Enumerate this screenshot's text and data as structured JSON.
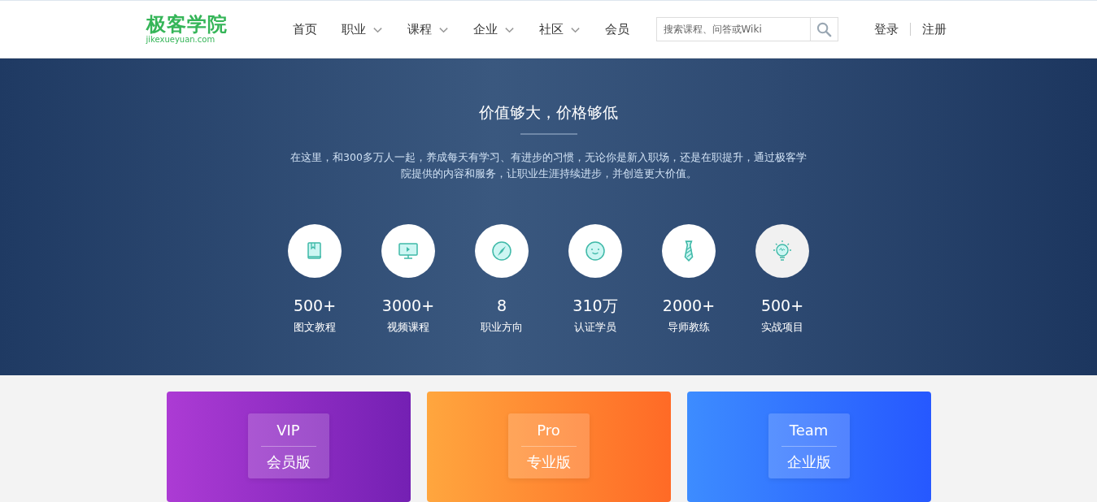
{
  "logo": {
    "name": "极客学院",
    "domain": "jikexueyuan.com"
  },
  "nav": [
    {
      "label": "首页",
      "has_menu": false
    },
    {
      "label": "职业",
      "has_menu": true
    },
    {
      "label": "课程",
      "has_menu": true
    },
    {
      "label": "企业",
      "has_menu": true
    },
    {
      "label": "社区",
      "has_menu": true
    },
    {
      "label": "会员",
      "has_menu": false
    }
  ],
  "search": {
    "placeholder": "搜索课程、问答或Wiki"
  },
  "auth": [
    "登录",
    "注册"
  ],
  "hero": {
    "title": "价值够大，价格够低",
    "text": "在这里，和300多万人一起，养成每天有学习、有进步的习惯，无论你是新入职场，还是在职提升，通过极客学院提供的内容和服务，让职业生涯持续进步，并创造更大价值。"
  },
  "stats": [
    {
      "kind": "book",
      "value": "500+",
      "label": "图文教程",
      "highlighted": false
    },
    {
      "kind": "monitor",
      "value": "3000+",
      "label": "视频课程",
      "highlighted": false
    },
    {
      "kind": "compass",
      "value": "8",
      "label": "职业方向",
      "highlighted": false
    },
    {
      "kind": "smiley",
      "value": "310万",
      "label": "认证学员",
      "highlighted": false
    },
    {
      "kind": "tie",
      "value": "2000+",
      "label": "导师教练",
      "highlighted": false
    },
    {
      "kind": "bulb",
      "value": "500+",
      "label": "实战项目",
      "highlighted": true
    }
  ],
  "plans": [
    {
      "kind": "vip",
      "badge": "VIP",
      "name": "会员版"
    },
    {
      "kind": "pro",
      "badge": "Pro",
      "name": "专业版"
    },
    {
      "kind": "team",
      "badge": "Team",
      "name": "企业版"
    }
  ]
}
